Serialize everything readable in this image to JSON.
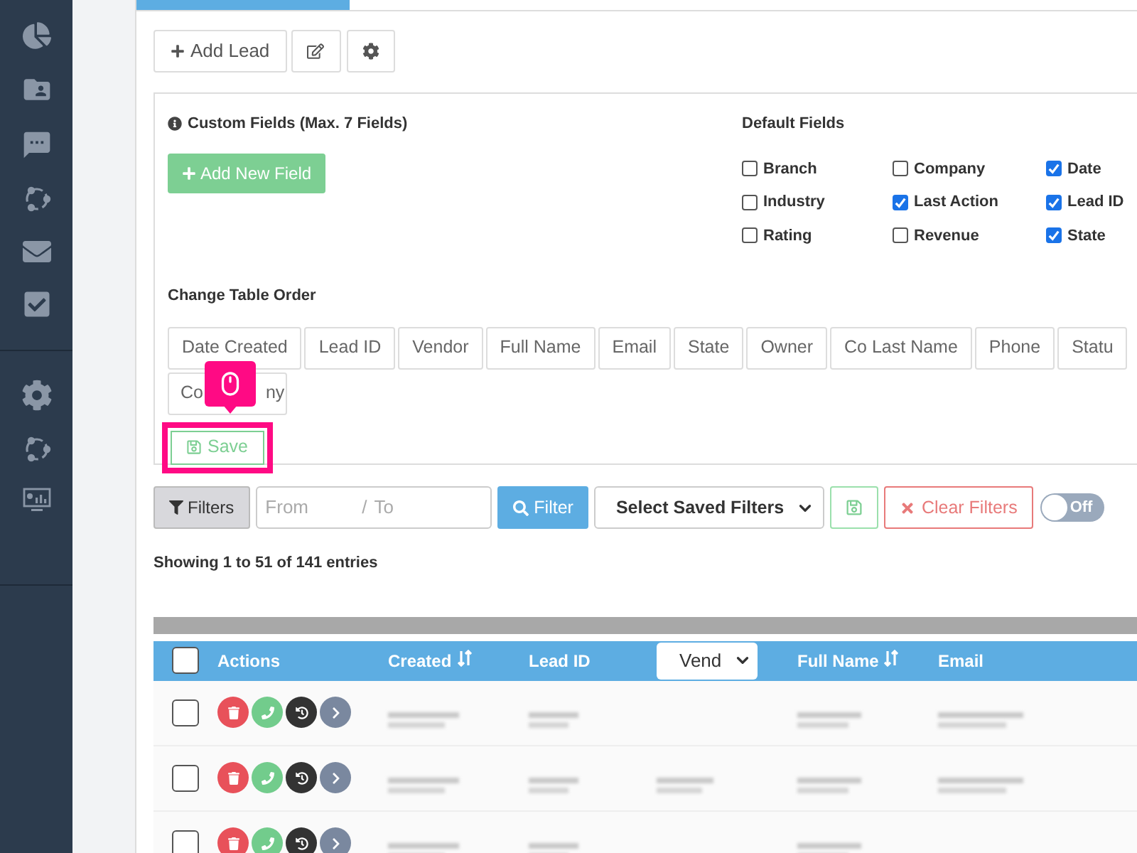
{
  "toolbar": {
    "add_lead": "Add Lead"
  },
  "custom_fields": {
    "title": "Custom Fields (Max. 7 Fields)",
    "add_button": "Add New Field"
  },
  "default_fields": {
    "title": "Default Fields",
    "items": [
      {
        "label": "Branch",
        "checked": false
      },
      {
        "label": "Company",
        "checked": false
      },
      {
        "label": "Date",
        "checked": true
      },
      {
        "label": "Industry",
        "checked": false
      },
      {
        "label": "Last Action",
        "checked": true
      },
      {
        "label": "Lead ID",
        "checked": true
      },
      {
        "label": "Rating",
        "checked": false
      },
      {
        "label": "Revenue",
        "checked": false
      },
      {
        "label": "State",
        "checked": true
      }
    ]
  },
  "table_order": {
    "title": "Change Table Order",
    "columns": [
      "Date Created",
      "Lead ID",
      "Vendor",
      "Full Name",
      "Email",
      "State",
      "Owner",
      "Co Last Name",
      "Phone",
      "Statu"
    ],
    "covered_column": {
      "before": "Co",
      "after": "ny"
    }
  },
  "save_button": {
    "label": "Save",
    "highlighted": true
  },
  "filters": {
    "filters_button": "Filters",
    "from_placeholder": "From",
    "separator": "/",
    "to_placeholder": "To",
    "filter_button": "Filter",
    "saved_filters": "Select Saved Filters",
    "clear_button": "Clear Filters",
    "toggle": {
      "label": "Off",
      "on": false
    }
  },
  "summary": "Showing 1 to 51 of 141 entries",
  "table": {
    "select_all_checked": false,
    "columns": [
      {
        "kind": "text",
        "label": "Actions",
        "sortable": false
      },
      {
        "kind": "text",
        "label": "Created",
        "sortable": true
      },
      {
        "kind": "text",
        "label": "Lead ID",
        "sortable": false
      },
      {
        "kind": "select",
        "label": "Vend"
      },
      {
        "kind": "text",
        "label": "Full Name",
        "sortable": true
      },
      {
        "kind": "text",
        "label": "Email",
        "sortable": false
      }
    ],
    "rows": [
      {
        "checked": false,
        "blurred": [
          true,
          true,
          false,
          true,
          true
        ]
      },
      {
        "checked": false,
        "blurred": [
          true,
          true,
          true,
          true,
          true
        ]
      },
      {
        "checked": false,
        "blurred": [
          true,
          true,
          false,
          true,
          false
        ]
      }
    ]
  }
}
